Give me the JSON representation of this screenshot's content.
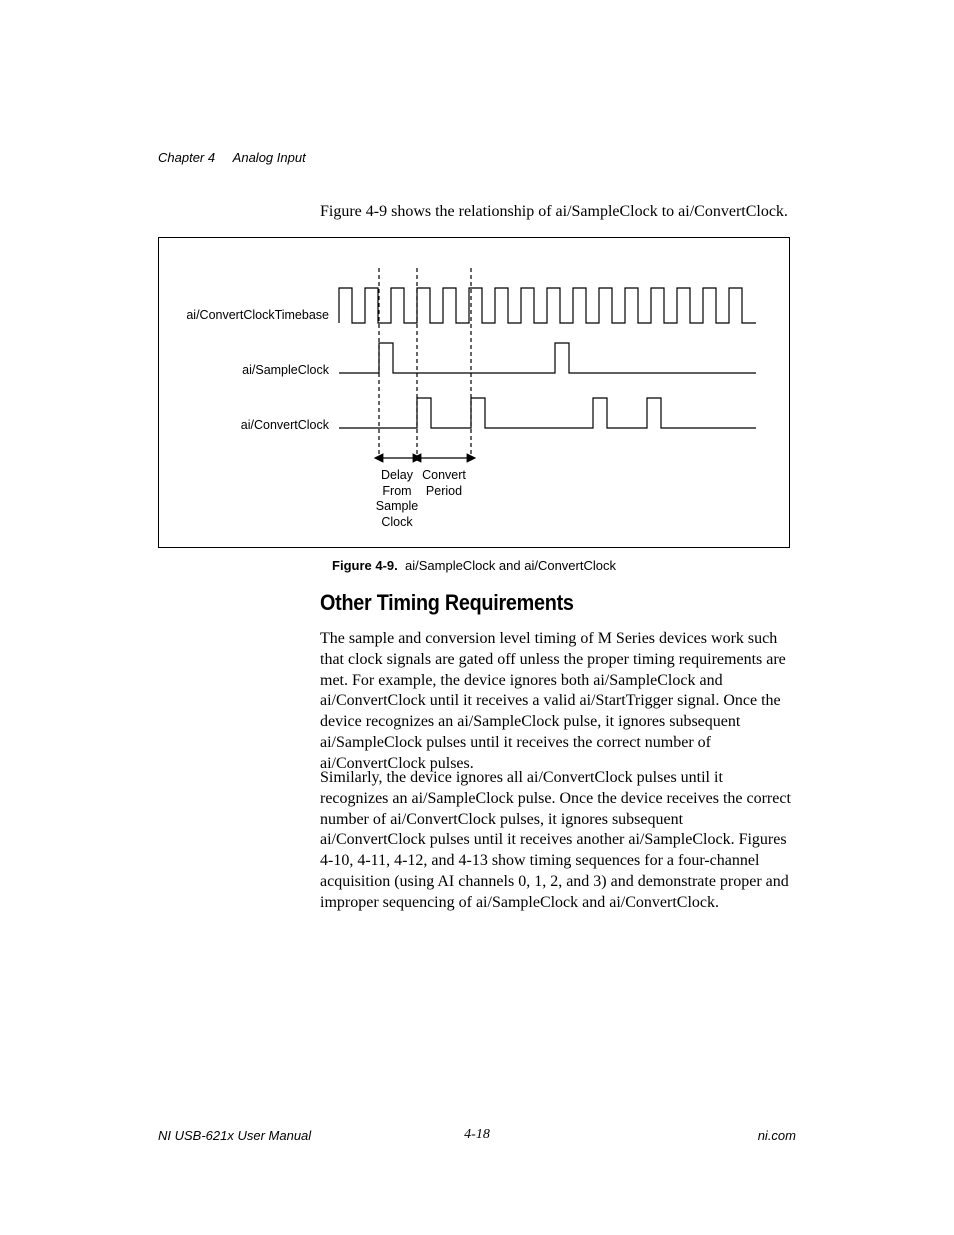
{
  "header": {
    "chapter": "Chapter 4",
    "title": "Analog Input"
  },
  "intro": "Figure 4-9 shows the relationship of ai/SampleClock to ai/ConvertClock.",
  "figure": {
    "signals": {
      "timebase": "ai/ConvertClockTimebase",
      "sample": "ai/SampleClock",
      "convert": "ai/ConvertClock"
    },
    "annotations": {
      "delay": "Delay\nFrom\nSample\nClock",
      "period": "Convert\nPeriod"
    },
    "caption_label": "Figure 4-9.",
    "caption_text": "ai/SampleClock and ai/ConvertClock"
  },
  "section_heading": "Other Timing Requirements",
  "paragraph1": "The sample and conversion level timing of M Series devices work such that clock signals are gated off unless the proper timing requirements are met. For example, the device ignores both ai/SampleClock and ai/ConvertClock until it receives a valid ai/StartTrigger signal. Once the device recognizes an ai/SampleClock pulse, it ignores subsequent ai/SampleClock pulses until it receives the correct number of ai/ConvertClock pulses.",
  "paragraph2": "Similarly, the device ignores all ai/ConvertClock pulses until it recognizes an ai/SampleClock pulse. Once the device receives the correct number of ai/ConvertClock pulses, it ignores subsequent ai/ConvertClock pulses until it receives another ai/SampleClock. Figures 4-10, 4-11, 4-12, and 4-13 show timing sequences for a four-channel acquisition (using AI channels 0, 1, 2, and 3) and demonstrate proper and improper sequencing of ai/SampleClock and ai/ConvertClock.",
  "footer": {
    "left": "NI USB-621x User Manual",
    "center": "4-18",
    "right": "ni.com"
  }
}
